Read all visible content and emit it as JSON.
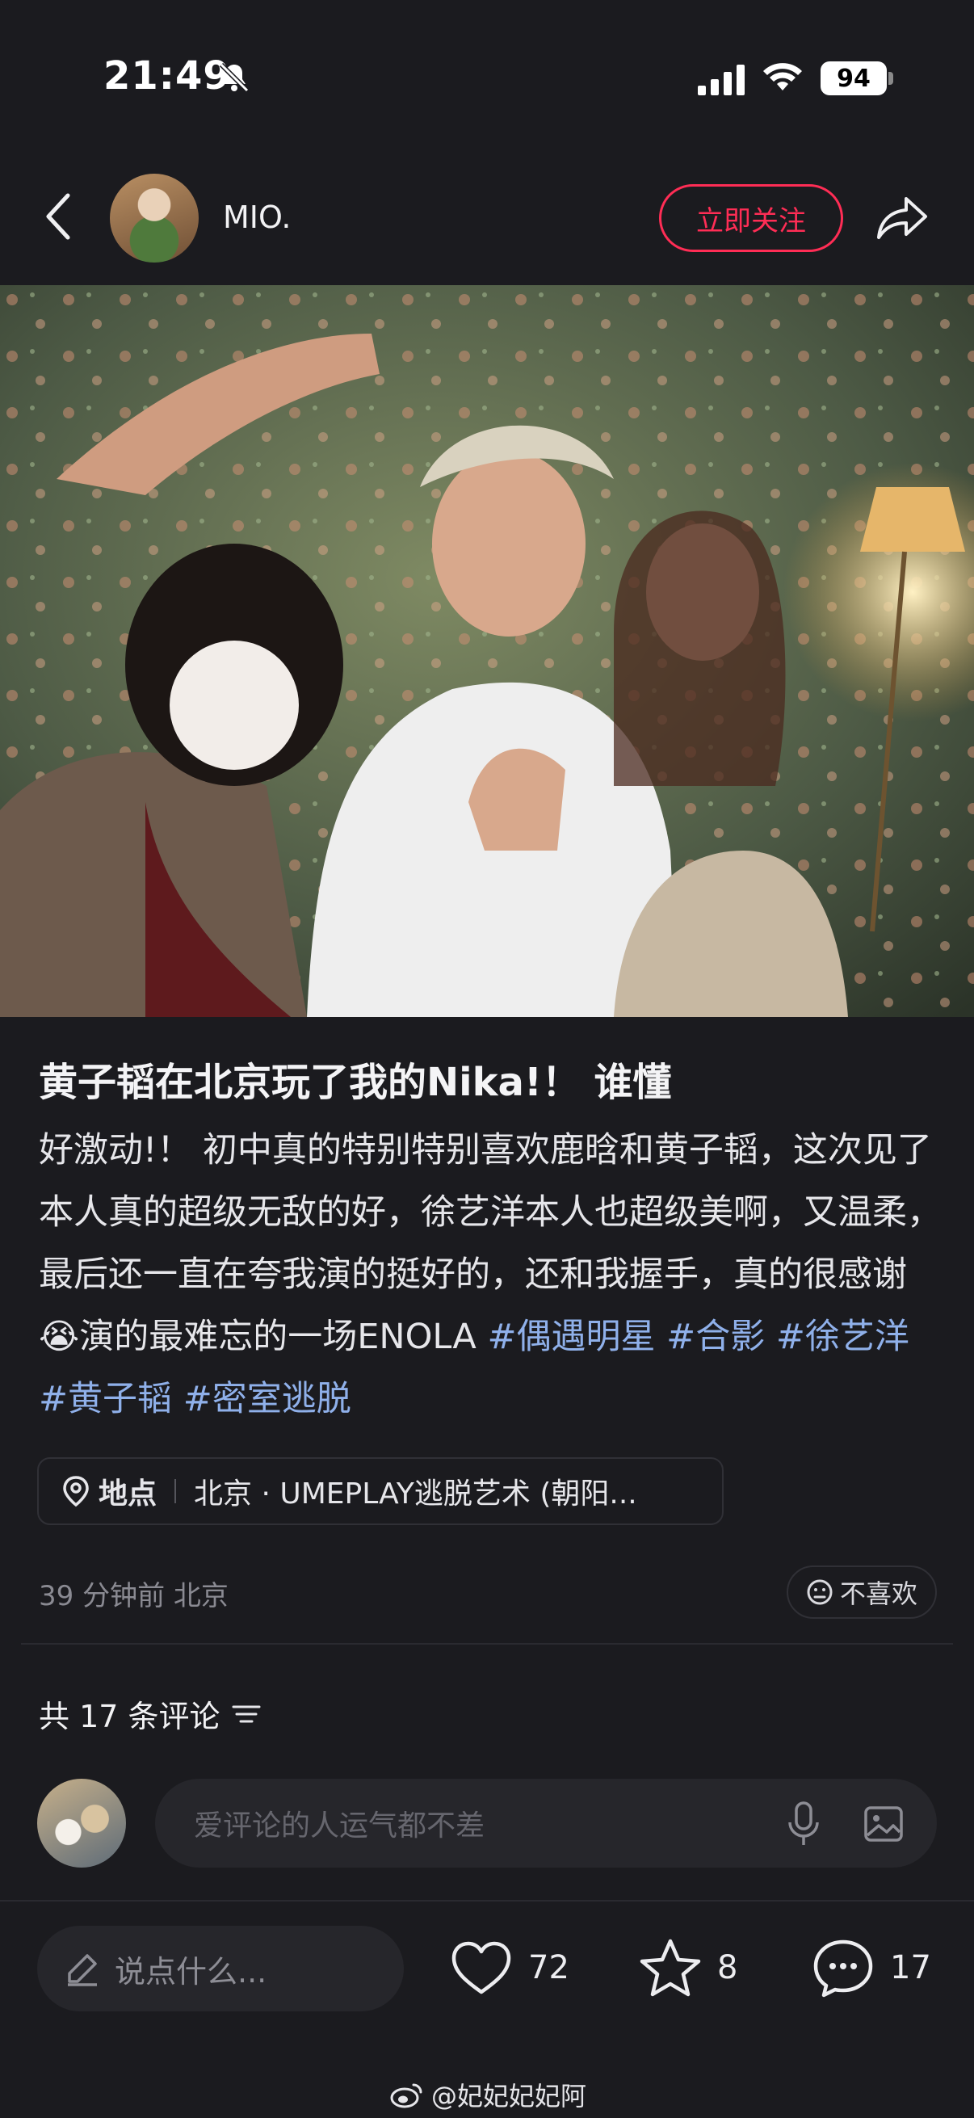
{
  "status": {
    "time": "21:49",
    "battery": "94"
  },
  "header": {
    "author": "MIO.",
    "follow_label": "立即关注"
  },
  "post": {
    "title": "黄子韬在北京玩了我的Nika!！ 谁懂",
    "text_a": "好激动!！ 初中真的特别特别喜欢鹿晗和黄子韬，这次见了本人真的超级无敌的好，徐艺洋本人也超级美啊，又温柔，最后还一直在夸我演的挺好的，还和我握手，真的很感谢",
    "emoji": "😭",
    "text_b": "演的最难忘的一场ENOLA ",
    "tags": [
      "#偶遇明星",
      "#合影",
      "#徐艺洋",
      "#黄子韬",
      "#密室逃脱"
    ],
    "location_label": "地点",
    "location_value": "北京 · UMEPLAY逃脱艺术 (朝阳...",
    "time_ago": "39 分钟前 北京",
    "dislike_label": "不喜欢"
  },
  "comments": {
    "count_label": "共 17 条评论",
    "input_placeholder": "爱评论的人运气都不差"
  },
  "bottom": {
    "say_placeholder": "说点什么...",
    "likes": "72",
    "stars": "8",
    "comments": "17"
  },
  "watermark": "@妃妃妃妃阿",
  "colors": {
    "accent": "#ff2d55",
    "tag": "#8fb0ea",
    "background": "#1b1b1f"
  },
  "icons": [
    "bell-off-icon",
    "signal-icon",
    "wifi-icon",
    "back-chevron-icon",
    "share-icon",
    "location-pin-icon",
    "neutral-face-icon",
    "sort-lines-icon",
    "mic-icon",
    "image-icon",
    "pencil-icon",
    "heart-icon",
    "star-icon",
    "comment-bubble-icon",
    "weibo-logo-icon"
  ]
}
